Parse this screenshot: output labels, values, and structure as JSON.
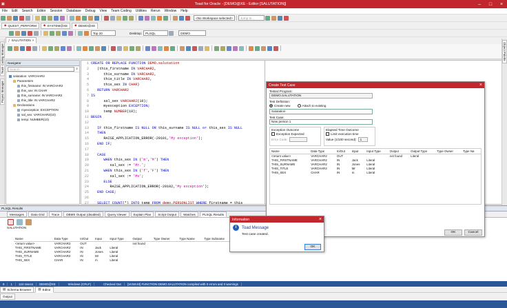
{
  "app": {
    "title": "Toad for Oracle - [DEMO@XE - Editor [SALUTATION]]"
  },
  "menu": [
    "File",
    "Edit",
    "Search",
    "Editor",
    "Session",
    "Database",
    "Debug",
    "View",
    "Team Coding",
    "Utilities",
    "Rerun",
    "Window",
    "Help"
  ],
  "toolbar": {
    "workspace": "<No Workspace selected>",
    "jump_placeholder": "Jump to...",
    "top_n": "Top 20",
    "desktop_label": "Desktop:",
    "desktop_value": "PLSQL",
    "schema": "DEMO"
  },
  "session_tabs": [
    "QUEST_PERFORM",
    "SYSTEM@XE",
    "DEMO@XE"
  ],
  "editor_tabs": [
    "SALUTATION"
  ],
  "side_tabs": {
    "left": [
      "Team Coding Manager",
      "Project Manager"
    ],
    "right": [
      "Object Palette"
    ]
  },
  "navigator": {
    "title": "Navigator",
    "search_placeholder": "Search",
    "items": [
      {
        "label": "salutation: VARCHAR2",
        "level": 0
      },
      {
        "label": "Parameters",
        "level": 1
      },
      {
        "label": "this_firstname: IN VARCHAR2",
        "level": 2
      },
      {
        "label": "this_sex: IN CHAR",
        "level": 2
      },
      {
        "label": "this_surname: IN VARCHAR2",
        "level": 2
      },
      {
        "label": "this_title: IN VARCHAR2",
        "level": 2
      },
      {
        "label": "Declarations",
        "level": 1
      },
      {
        "label": "myexception: EXCEPTION",
        "level": 2
      },
      {
        "label": "sal_sex: VARCHAR2(10)",
        "level": 2
      },
      {
        "label": "temp: NUMBER(10)",
        "level": 2
      }
    ]
  },
  "code": [
    {
      "n": "1",
      "t": [
        [
          "kw",
          "CREATE OR REPLACE FUNCTION "
        ],
        [
          "fn",
          "DEMO.salutation"
        ]
      ]
    },
    {
      "n": "2",
      "t": [
        [
          "idn",
          "   (this_firstname "
        ],
        [
          "kw",
          "IN "
        ],
        [
          "fn",
          "VARCHAR2"
        ],
        [
          "idn",
          ","
        ]
      ]
    },
    {
      "n": "3",
      "t": [
        [
          "idn",
          "      this_surname "
        ],
        [
          "kw",
          "IN "
        ],
        [
          "fn",
          "VARCHAR2"
        ],
        [
          "idn",
          ","
        ]
      ]
    },
    {
      "n": "4",
      "t": [
        [
          "idn",
          "      this_title "
        ],
        [
          "kw",
          "IN "
        ],
        [
          "fn",
          "VARCHAR2"
        ],
        [
          "idn",
          ","
        ]
      ]
    },
    {
      "n": "5",
      "t": [
        [
          "idn",
          "      this_sex "
        ],
        [
          "kw",
          "IN "
        ],
        [
          "fn",
          "CHAR"
        ],
        [
          "idn",
          ")"
        ]
      ]
    },
    {
      "n": "6",
      "t": [
        [
          "kw",
          "   RETURN "
        ],
        [
          "fn",
          "VARCHAR2"
        ]
      ]
    },
    {
      "n": "7",
      "t": [
        [
          "kw",
          "IS"
        ]
      ]
    },
    {
      "n": "8",
      "t": [
        [
          "idn",
          "      sal_sex "
        ],
        [
          "fn",
          "VARCHAR2"
        ],
        [
          "idn",
          "(10);"
        ]
      ]
    },
    {
      "n": "9",
      "t": [
        [
          "idn",
          "      myexception "
        ],
        [
          "kw",
          "EXCEPTION"
        ],
        [
          "idn",
          ";"
        ]
      ]
    },
    {
      "n": "10",
      "t": [
        [
          "idn",
          "      temp "
        ],
        [
          "fn",
          "NUMBER"
        ],
        [
          "idn",
          "(10);"
        ]
      ]
    },
    {
      "n": "11",
      "t": [
        [
          "kw",
          "BEGIN"
        ]
      ]
    },
    {
      "n": "12",
      "t": []
    },
    {
      "n": "13",
      "t": [
        [
          "kw",
          "   IF "
        ],
        [
          "idn",
          "this_firstname "
        ],
        [
          "kw",
          "IS NULL OR "
        ],
        [
          "idn",
          "this_surname "
        ],
        [
          "kw",
          "IS NULL or "
        ],
        [
          "idn",
          "this_sex "
        ],
        [
          "kw",
          "IS NULL"
        ]
      ]
    },
    {
      "n": "14",
      "t": [
        [
          "kw",
          "   THEN"
        ]
      ]
    },
    {
      "n": "15",
      "t": [
        [
          "idn",
          "      RAISE_APPLICATION_ERROR(-20101,"
        ],
        [
          "str",
          "'My exception'"
        ],
        [
          "idn",
          ");"
        ]
      ]
    },
    {
      "n": "16",
      "t": [
        [
          "kw",
          "   END IF"
        ],
        [
          "idn",
          ";"
        ]
      ]
    },
    {
      "n": "17",
      "t": []
    },
    {
      "n": "18",
      "t": [
        [
          "kw",
          "   CASE"
        ]
      ]
    },
    {
      "n": "19",
      "t": [
        [
          "kw",
          "      WHEN "
        ],
        [
          "idn",
          "this_sex "
        ],
        [
          "kw",
          "IN "
        ],
        [
          "idn",
          "("
        ],
        [
          "str",
          "'m'"
        ],
        [
          "idn",
          ","
        ],
        [
          "str",
          "'M'"
        ],
        [
          "idn",
          ") "
        ],
        [
          "kw",
          "THEN"
        ]
      ]
    },
    {
      "n": "20",
      "t": [
        [
          "idn",
          "         sal_sex := "
        ],
        [
          "str",
          "'Mr.'"
        ],
        [
          "idn",
          ";"
        ]
      ]
    },
    {
      "n": "21",
      "t": [
        [
          "kw",
          "      WHEN "
        ],
        [
          "idn",
          "this_sex "
        ],
        [
          "kw",
          "IN "
        ],
        [
          "idn",
          "("
        ],
        [
          "str",
          "'f'"
        ],
        [
          "idn",
          ","
        ],
        [
          "str",
          "'F'"
        ],
        [
          "idn",
          ") "
        ],
        [
          "kw",
          "THEN"
        ]
      ]
    },
    {
      "n": "22",
      "t": [
        [
          "idn",
          "         sal_sex := "
        ],
        [
          "str",
          "'Ms'"
        ],
        [
          "idn",
          ";"
        ]
      ]
    },
    {
      "n": "23",
      "t": [
        [
          "kw",
          "      ELSE"
        ]
      ]
    },
    {
      "n": "24",
      "t": [
        [
          "idn",
          "         RAISE_APPLICATION_ERROR(-20102,"
        ],
        [
          "str",
          "'My exception'"
        ],
        [
          "idn",
          ");"
        ]
      ]
    },
    {
      "n": "25",
      "t": [
        [
          "kw",
          "   END CASE"
        ],
        [
          "idn",
          ";"
        ]
      ]
    },
    {
      "n": "26",
      "t": []
    },
    {
      "n": "27",
      "t": [
        [
          "kw",
          "   SELECT COUNT"
        ],
        [
          "idn",
          "(*) "
        ],
        [
          "kw",
          "INTO "
        ],
        [
          "idn",
          "temp "
        ],
        [
          "kw",
          "FROM "
        ],
        [
          "fn",
          "demo.PERSONLIST "
        ],
        [
          "kw",
          "WHERE "
        ],
        [
          "idn",
          "firstname = this_"
        ]
      ]
    },
    {
      "n": "28",
      "t": [
        [
          "kw",
          "   IF NOT "
        ],
        [
          "idn",
          "temp > 0 "
        ],
        [
          "kw",
          "THEN"
        ]
      ]
    },
    {
      "n": "29",
      "t": [
        [
          "kw",
          "      RETURN "
        ],
        [
          "str",
          "'not found'"
        ],
        [
          "idn",
          ";"
        ]
      ]
    },
    {
      "n": "30",
      "t": [
        [
          "kw",
          "   END IF"
        ],
        [
          "idn",
          ";"
        ]
      ]
    }
  ],
  "results": {
    "title": "PLSQL Results",
    "tabs": [
      "Messages",
      "Data Grid",
      "Trace",
      "DBMS Output (disabled)",
      "Query Viewer",
      "Explain Plan",
      "Script Output",
      "Watches",
      "PLSQL Results"
    ],
    "object": "SALUTATION",
    "headers": [
      "Name",
      "Data Type",
      "In/Out",
      "Input",
      "Input Type",
      "Output",
      "Type Owner",
      "Type Name",
      "Type Subname"
    ],
    "rows": [
      [
        "<return value>",
        "VARCHAR2",
        "OUT",
        "",
        "",
        "not found",
        "",
        "",
        ""
      ],
      [
        "THIS_FIRSTNAME",
        "VARCHAR2",
        "IN",
        "Jack",
        "Literal",
        "",
        "",
        "",
        ""
      ],
      [
        "THIS_SURNAME",
        "VARCHAR2",
        "IN",
        "Jones",
        "Literal",
        "",
        "",
        "",
        ""
      ],
      [
        "THIS_TITLE",
        "VARCHAR2",
        "IN",
        "Mr",
        "Literal",
        "",
        "",
        "",
        ""
      ],
      [
        "THIS_SEX",
        "CHAR",
        "IN",
        "m",
        "Literal",
        "",
        "",
        "",
        ""
      ]
    ]
  },
  "create_test": {
    "title": "Create Test Case",
    "tested_program_label": "Tested Program:",
    "tested_program": "DEMO.SALUTATION",
    "test_def_label": "Test Definition:",
    "opt_create": "Create new",
    "opt_attach": "Attach to existing",
    "def_value": "Salutation",
    "test_case_label": "Test Case:",
    "test_case_value": "New person 1",
    "exc_group": "Exception Outcome",
    "exc_expected": "Exception Expected",
    "err_code_label": "Error Code:",
    "time_group": "Elapsed Time Outcome",
    "limit_exec": "Limit execution time",
    "value_label": "Value (1/100 second):",
    "value": "1",
    "headers": [
      "Name",
      "Data Type",
      "In/Out",
      "Input",
      "Input Type",
      "Output",
      "Output Type",
      "Type Owner",
      "Type Na"
    ],
    "rows": [
      [
        "<return value>",
        "VARCHAR2",
        "OUT",
        "",
        "",
        "not found",
        "Literal",
        "",
        ""
      ],
      [
        "THIS_FIRSTNAME",
        "VARCHAR2",
        "IN",
        "Jack",
        "Literal",
        "",
        "",
        "",
        ""
      ],
      [
        "THIS_SURNAME",
        "VARCHAR2",
        "IN",
        "Jones",
        "Literal",
        "",
        "",
        "",
        ""
      ],
      [
        "THIS_TITLE",
        "VARCHAR2",
        "IN",
        "Mr",
        "Literal",
        "",
        "",
        "",
        ""
      ],
      [
        "THIS_SEX",
        "CHAR",
        "IN",
        "m",
        "Literal",
        "",
        "",
        "",
        ""
      ]
    ],
    "ok": "OK",
    "cancel": "Cancel"
  },
  "info": {
    "title": "Information",
    "heading": "Toad Message",
    "message": "Test case created.",
    "ok": "OK"
  },
  "status": [
    "8",
    "1",
    "124 msecs",
    "DEMO@XE",
    "",
    "Windows (CRLF)",
    "",
    "Checked Out",
    "[16:58:40] FUNCTION DEMO.SALUTATION compiled with 0 errors and 0 warnings"
  ],
  "bottom_tabs": [
    "Schema Browser",
    "Editor"
  ],
  "output_tab": "Output",
  "colors": {
    "accent": "#c1272d",
    "keyword": "#0000c8",
    "string": "#c8009a",
    "type": "#a00000"
  }
}
